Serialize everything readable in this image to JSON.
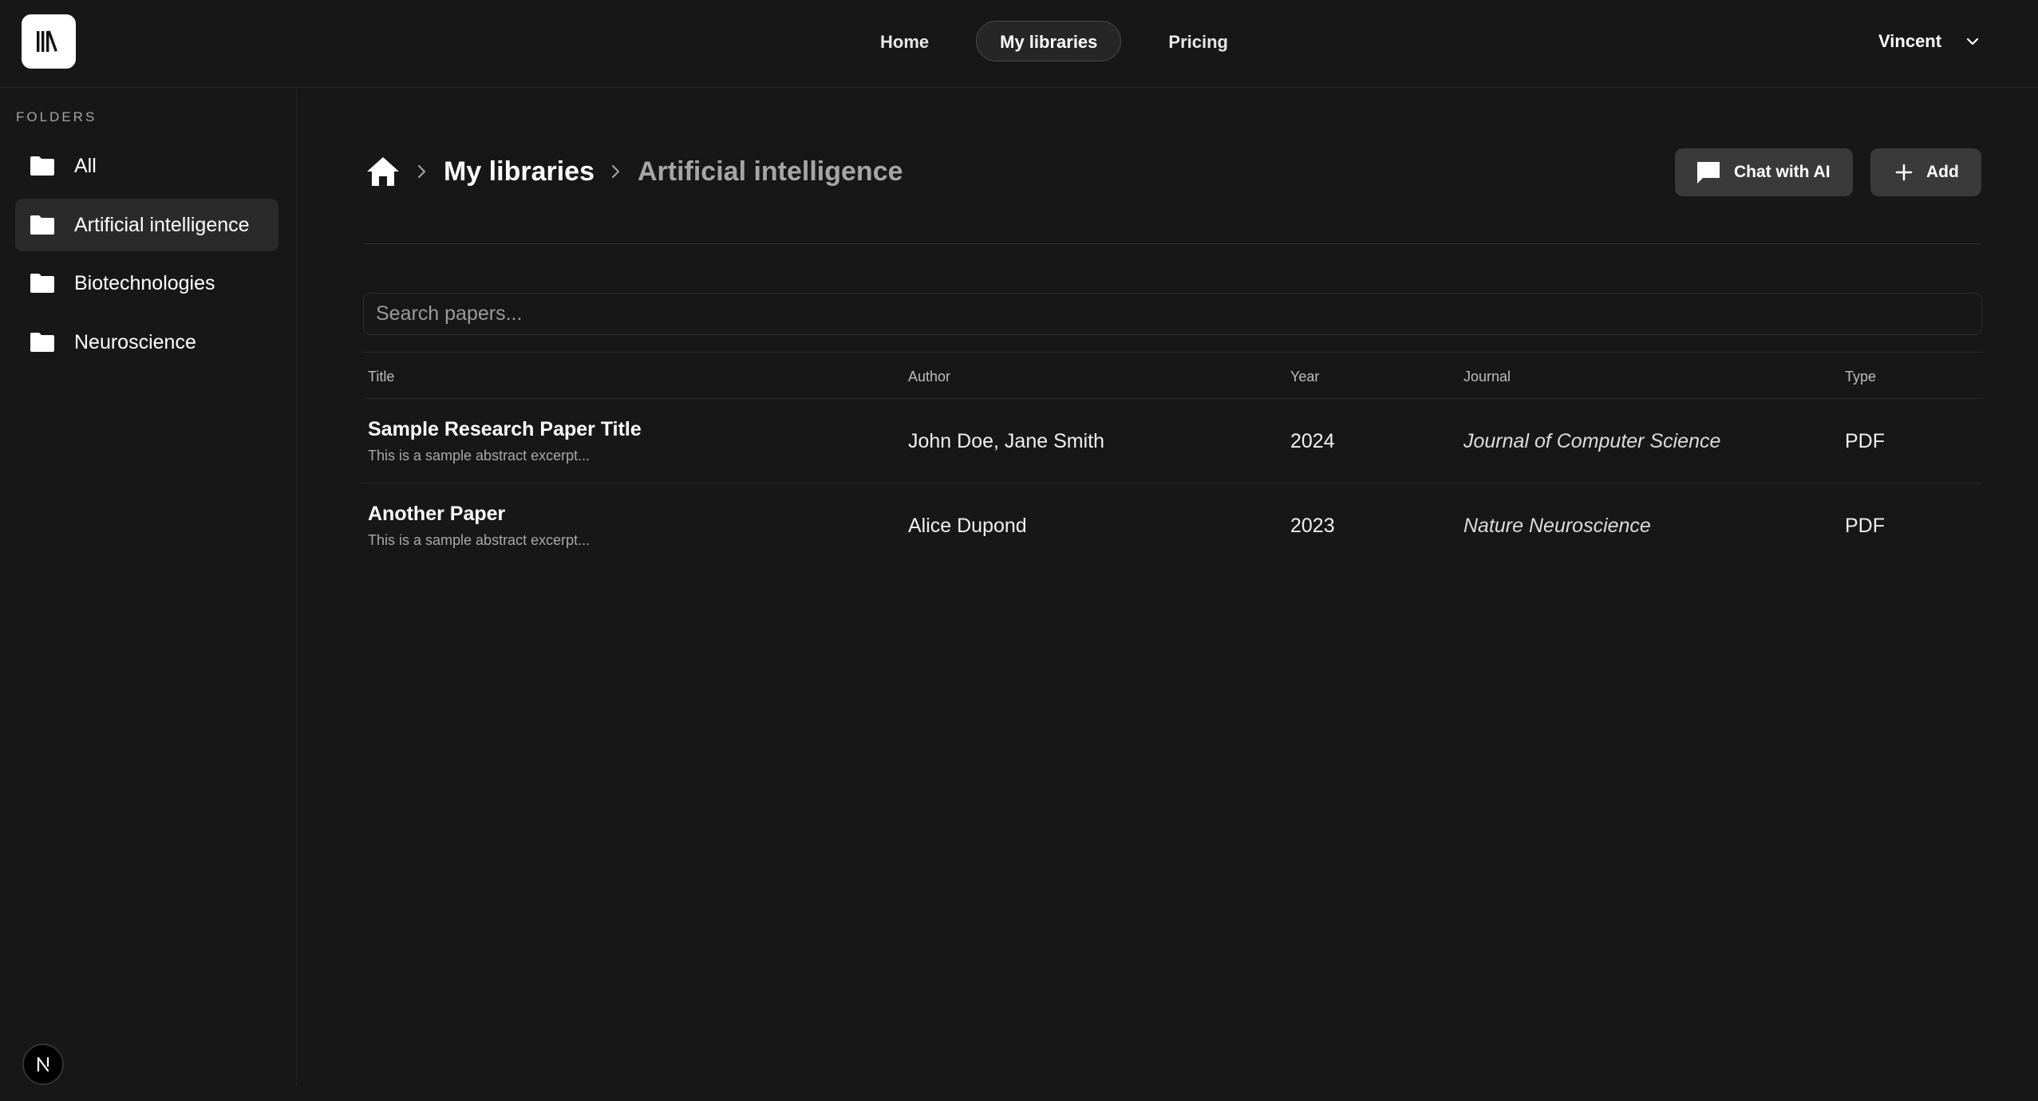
{
  "nav": {
    "logo_icon": "library-books-icon",
    "items": [
      {
        "label": "Home",
        "active": false
      },
      {
        "label": "My libraries",
        "active": true
      },
      {
        "label": "Pricing",
        "active": false
      }
    ],
    "user": {
      "name": "Vincent",
      "menu_icon": "chevron-down-icon"
    }
  },
  "sidebar": {
    "heading": "FOLDERS",
    "folders": [
      {
        "label": "All",
        "active": false,
        "icon": "folder-icon"
      },
      {
        "label": "Artificial intelligence",
        "active": true,
        "icon": "folder-icon"
      },
      {
        "label": "Biotechnologies",
        "active": false,
        "icon": "folder-icon"
      },
      {
        "label": "Neuroscience",
        "active": false,
        "icon": "folder-icon"
      }
    ],
    "badge": "N"
  },
  "breadcrumb": {
    "home_icon": "home-icon",
    "items": [
      "My libraries",
      "Artificial intelligence"
    ]
  },
  "actions": {
    "chat_label": "Chat with AI",
    "chat_icon": "chat-bubble-icon",
    "add_label": "Add",
    "add_icon": "plus-icon"
  },
  "search": {
    "placeholder": "Search papers...",
    "value": ""
  },
  "table": {
    "columns": [
      "Title",
      "Author",
      "Year",
      "Journal",
      "Type"
    ],
    "rows": [
      {
        "title": "Sample Research Paper Title",
        "abstract": "This is a sample abstract excerpt...",
        "author": "John Doe, Jane Smith",
        "year": "2024",
        "journal": "Journal of Computer Science",
        "type": "PDF"
      },
      {
        "title": "Another Paper",
        "abstract": "This is a sample abstract excerpt...",
        "author": "Alice Dupond",
        "year": "2023",
        "journal": "Nature Neuroscience",
        "type": "PDF"
      }
    ]
  },
  "colors": {
    "background": "#171717",
    "active_surface": "#2a2a2a",
    "button": "#3a3a3a",
    "text": "#ffffff",
    "muted": "#a3a3a3"
  }
}
